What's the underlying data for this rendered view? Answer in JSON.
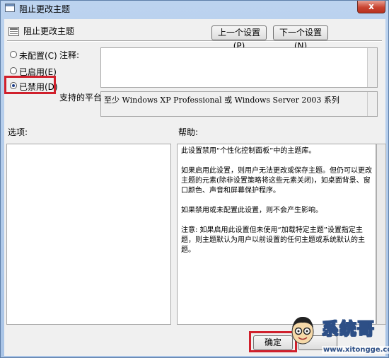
{
  "window": {
    "title": "阻止更改主题",
    "close_glyph": "x"
  },
  "header": {
    "title": "阻止更改主题",
    "prev_button": "上一个设置(P)",
    "next_button": "下一个设置(N)"
  },
  "state": {
    "options": [
      {
        "label": "未配置(C)",
        "checked": false
      },
      {
        "label": "已启用(E)",
        "checked": false
      },
      {
        "label": "已禁用(D)",
        "checked": true
      }
    ]
  },
  "comment": {
    "label": "注释:",
    "value": ""
  },
  "platform": {
    "label": "支持的平台:",
    "value": "至少 Windows XP Professional 或 Windows Server 2003 系列"
  },
  "options_pane": {
    "label": "选项:"
  },
  "help_pane": {
    "label": "帮助:",
    "paragraphs": [
      "此设置禁用“个性化控制面板”中的主题库。",
      "如果启用此设置，则用户无法更改或保存主题。但仍可以更改主题的元素(除非设置策略将这些元素关闭)，如桌面背景、窗口颜色、声音和屏幕保护程序。",
      "如果禁用或未配置此设置，则不会产生影响。",
      "注意: 如果启用此设置但未使用“加载特定主题”设置指定主题，则主题默认为用户以前设置的任何主题或系统默认的主题。"
    ]
  },
  "footer": {
    "ok_button": "确定",
    "cancel_button": ""
  },
  "watermark": {
    "name": "系统哥",
    "url": "www.xitongge.com"
  },
  "colors": {
    "highlight": "#d0202c",
    "title_bg": "#bcd3ef",
    "close_button": "#c94532"
  }
}
